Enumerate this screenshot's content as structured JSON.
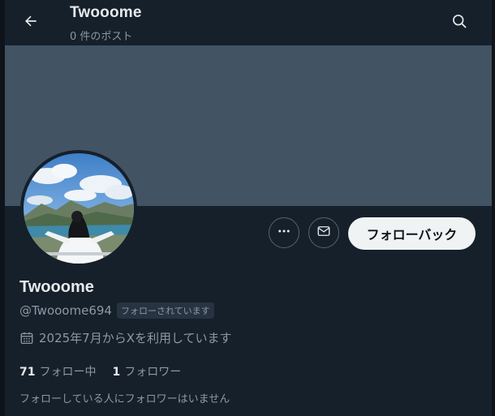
{
  "header": {
    "title": "Twooome",
    "post_count": "0 件のポスト"
  },
  "profile": {
    "display_name": "Twooome",
    "handle": "@Twooome694",
    "follows_you_badge": "フォローされています",
    "joined": "2025年7月からXを利用しています",
    "following_count": "71",
    "following_label": "フォロー中",
    "followers_count": "1",
    "followers_label": "フォロワー",
    "known_followers": "フォローしている人にフォロワーはいません"
  },
  "actions": {
    "follow_back_label": "フォローバック"
  },
  "icons": {
    "back": "arrow-left-icon",
    "search": "search-icon",
    "more": "more-dots-icon",
    "message": "mail-icon",
    "calendar": "calendar-icon"
  },
  "colors": {
    "background": "#15202b",
    "banner": "#425363",
    "primary_text": "#e7e9ea",
    "secondary_text": "#8b98a5",
    "button_bg": "#eff3f4"
  }
}
